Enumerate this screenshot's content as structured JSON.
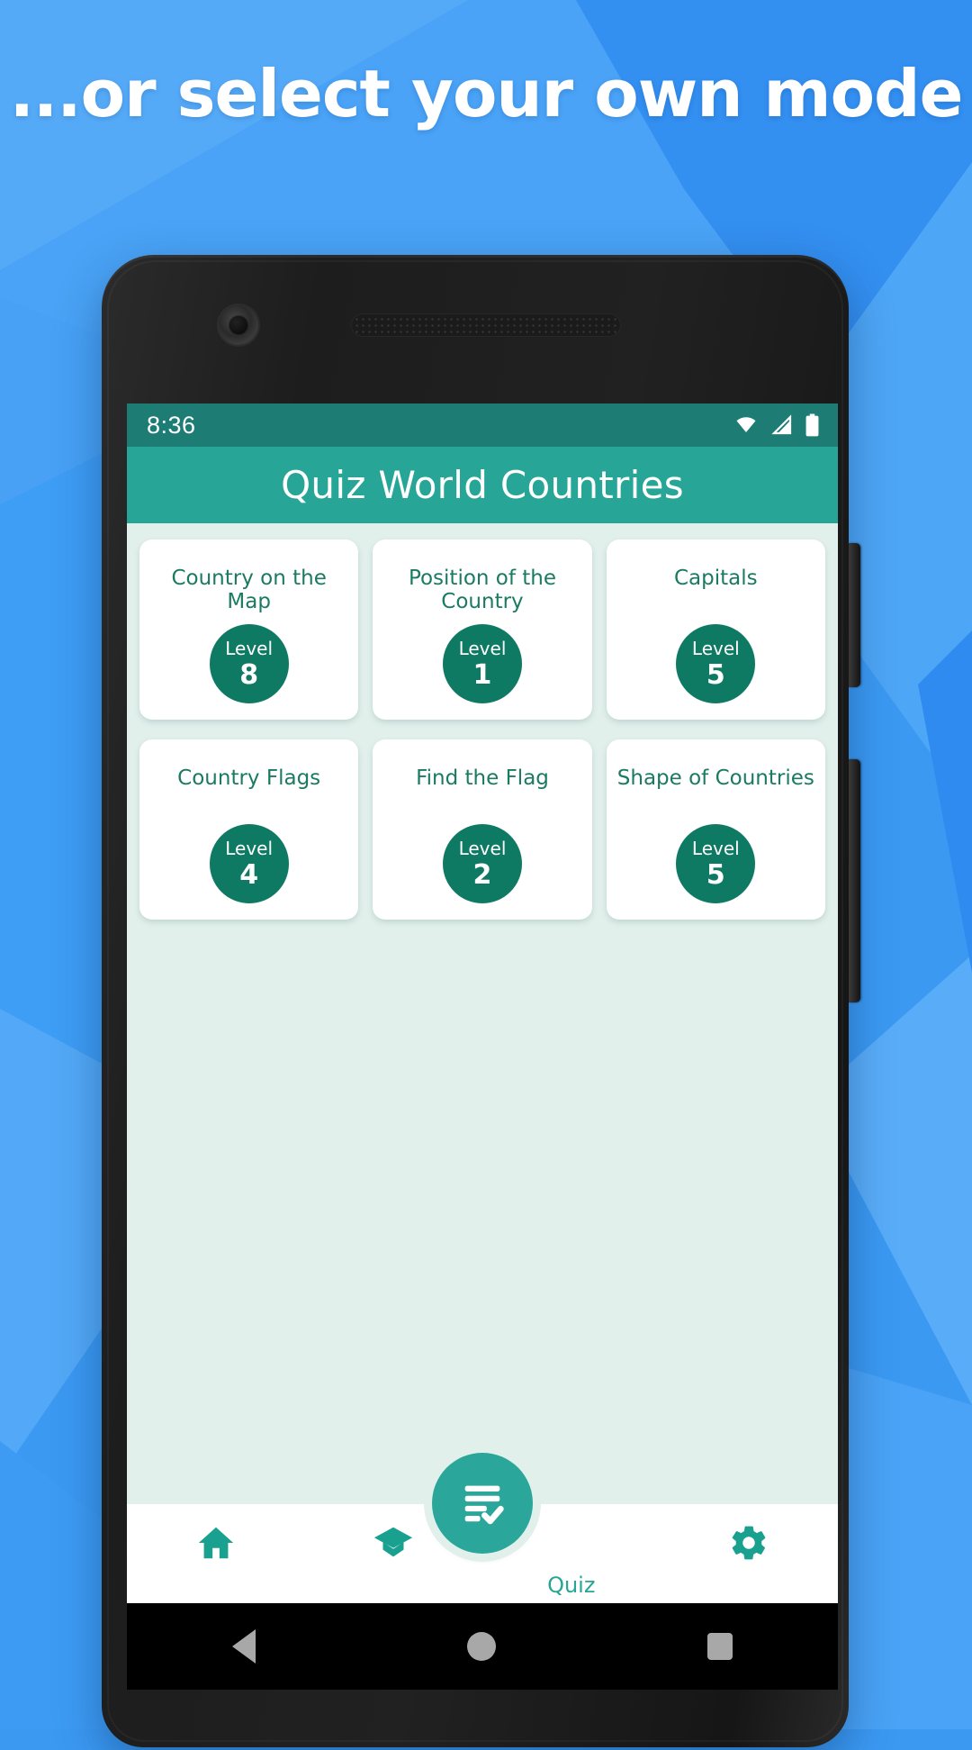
{
  "headline": "...or select your own mode",
  "colors": {
    "background_blue": "#3b99f2",
    "statusbar_teal": "#1d7d75",
    "appbar_teal": "#27a597",
    "content_mint": "#e2f0ec",
    "badge_green": "#0f7a63",
    "card_title_green": "#1b7a62",
    "fab_teal": "#2aa79a"
  },
  "status_bar": {
    "time": "8:36",
    "icons": [
      "wifi-icon",
      "signal-icon",
      "battery-icon"
    ]
  },
  "app_bar": {
    "title": "Quiz World Countries"
  },
  "modes": [
    {
      "title": "Country on the Map",
      "level_word": "Level",
      "level_value": "8"
    },
    {
      "title": "Position of the Country",
      "level_word": "Level",
      "level_value": "1"
    },
    {
      "title": "Capitals",
      "level_word": "Level",
      "level_value": "5"
    },
    {
      "title": "Country Flags",
      "level_word": "Level",
      "level_value": "4"
    },
    {
      "title": "Find the Flag",
      "level_word": "Level",
      "level_value": "2"
    },
    {
      "title": "Shape of Countries",
      "level_word": "Level",
      "level_value": "5"
    }
  ],
  "bottom_nav": {
    "items": [
      {
        "icon": "home-icon",
        "label": ""
      },
      {
        "icon": "graduation-cap-icon",
        "label": ""
      },
      {
        "icon": "checklist-icon",
        "label": "Quiz"
      },
      {
        "icon": "gear-icon",
        "label": ""
      }
    ]
  },
  "android_nav": {
    "back": "back-triangle-icon",
    "home": "home-circle-icon",
    "recents": "recents-square-icon"
  }
}
